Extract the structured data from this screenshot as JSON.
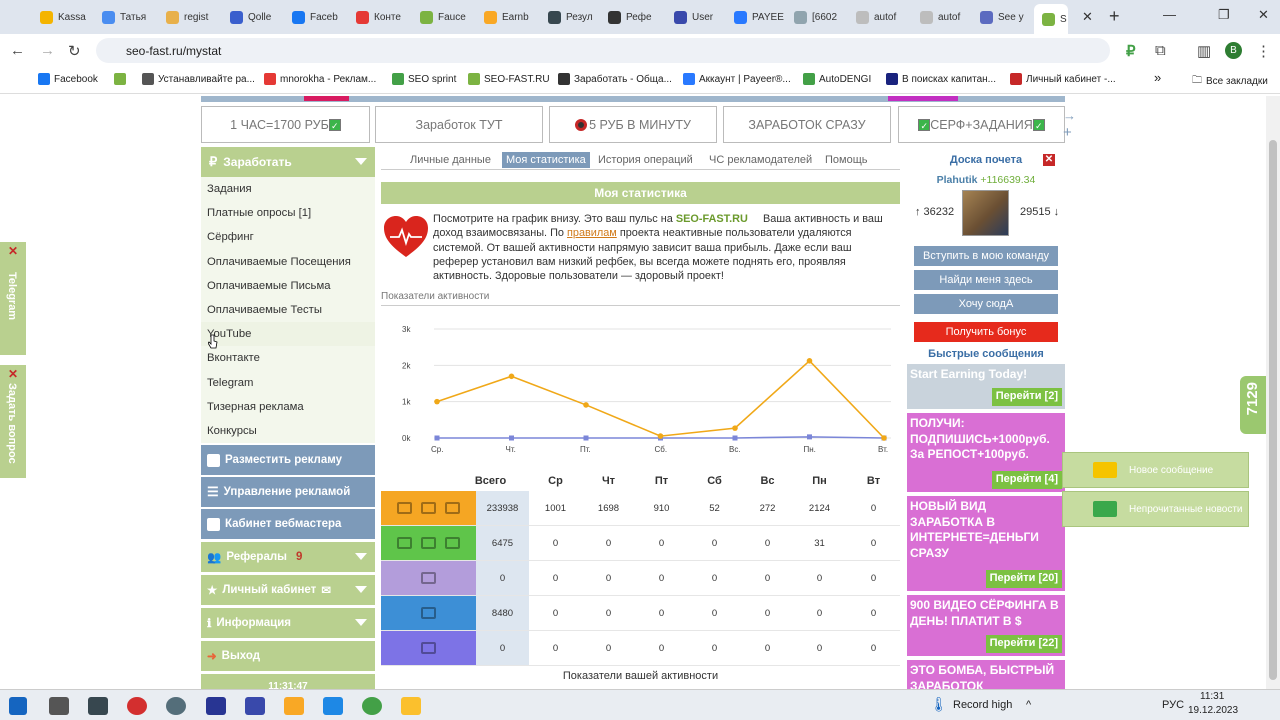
{
  "browser": {
    "tabs": [
      {
        "label": "Kassa",
        "color": "#f4b400"
      },
      {
        "label": "Татья",
        "color": "#4a8df0"
      },
      {
        "label": "regist",
        "color": "#e8b04a"
      },
      {
        "label": "Qolle",
        "color": "#3a5fcd"
      },
      {
        "label": "Faceb",
        "color": "#1877f2"
      },
      {
        "label": "Конте",
        "color": "#e53935"
      },
      {
        "label": "Fauce",
        "color": "#7cb342"
      },
      {
        "label": "Earnb",
        "color": "#f9a825"
      },
      {
        "label": "Резул",
        "color": "#37474f"
      },
      {
        "label": "Рефе",
        "color": "#333333"
      },
      {
        "label": "User",
        "color": "#3949ab"
      },
      {
        "label": "PAYEE",
        "color": "#2979ff"
      },
      {
        "label": "[6602",
        "color": "#90a4ae"
      },
      {
        "label": "autof",
        "color": "#bdbdbd"
      },
      {
        "label": "autof",
        "color": "#bdbdbd"
      },
      {
        "label": "See y",
        "color": "#5c6bc0"
      },
      {
        "label": "S",
        "color": "#7cb342"
      }
    ],
    "url": "seo-fast.ru/mystat",
    "bookmarks": [
      {
        "label": "Facebook",
        "color": "#1877f2"
      },
      {
        "label": "",
        "color": "#7cb342"
      },
      {
        "label": "Устанавливайте ра...",
        "color": "#555555"
      },
      {
        "label": "mnorokha - Реклам...",
        "color": "#e53935"
      },
      {
        "label": "SEO sprint",
        "color": "#43a047"
      },
      {
        "label": "SEO-FAST.RU",
        "color": "#7cb342"
      },
      {
        "label": "Заработать - Обща...",
        "color": "#333333"
      },
      {
        "label": "Аккаунт | Payeer®...",
        "color": "#2979ff"
      },
      {
        "label": "AutoDENGI",
        "color": "#43a047"
      },
      {
        "label": "В поисках капитан...",
        "color": "#1a237e"
      },
      {
        "label": "Личный кабинет -...",
        "color": "#c62828"
      }
    ],
    "all_bookmarks": "Все закладки",
    "profile": "B"
  },
  "top_buttons": [
    "1 ЧАС=1700 РУБ",
    "Заработок ТУТ",
    "5 РУБ В МИНУТУ",
    "ЗАРАБОТОК СРАЗУ",
    "СЕРФ+ЗАДАНИЯ"
  ],
  "sidebar": {
    "earn": "Заработать",
    "items": [
      "Задания",
      "Платные опросы [1]",
      "Сёрфинг",
      "Оплачиваемые Посещения",
      "Оплачиваемые Письма",
      "Оплачиваемые Тесты",
      "YouTube",
      "Вконтакте",
      "Telegram",
      "Тизерная реклама",
      "Конкурсы"
    ],
    "place_ad": "Разместить рекламу",
    "manage_ad": "Управление рекламой",
    "webmaster": "Кабинет вебмастера",
    "referrals": "Рефералы",
    "referrals_count": "9",
    "cabinet": "Личный кабинет",
    "info": "Информация",
    "logout": "Выход",
    "time": "11:31:47"
  },
  "subtabs": [
    "Личные данные",
    "Моя статистика",
    "История операций",
    "ЧС рекламодателей",
    "Помощь"
  ],
  "main": {
    "title": "Моя статистика",
    "intro_a": "Посмотрите на график внизу. Это ваш пульс на ",
    "brand": "SEO-FAST.RU",
    "intro_b": "     Ваша активность и ваш доход взаимосвязаны. По ",
    "rules": "правилам",
    "intro_c": " проекта неактивные пользователи удаляются системой. От вашей активности напрямую зависит ваша прибыль. Даже если ваш реферер установил вам низкий рефбек, вы всегда можете поднять его, проявляя активность. Здоровые пользователи — здоровый проект!",
    "activity_title": "Показатели активности",
    "footer": "Показатели вашей активности"
  },
  "chart_data": {
    "type": "line",
    "categories": [
      "Ср.",
      "Чт.",
      "Пт.",
      "Сб.",
      "Вс.",
      "Пн.",
      "Вт."
    ],
    "yticks": [
      "0k",
      "1k",
      "2k",
      "3k"
    ],
    "ylim": [
      0,
      3000
    ],
    "series": [
      {
        "color": "#f0a818",
        "values": [
          1001,
          1698,
          910,
          52,
          272,
          2124,
          0
        ]
      },
      {
        "color": "#7b86d8",
        "values": [
          0,
          0,
          0,
          0,
          0,
          31,
          0
        ]
      }
    ]
  },
  "stats": {
    "headers": [
      "Всего",
      "Ср",
      "Чт",
      "Пт",
      "Сб",
      "Вс",
      "Пн",
      "Вт"
    ],
    "rows": [
      {
        "color": "#f5a623",
        "total": "233938",
        "values": [
          "1001",
          "1698",
          "910",
          "52",
          "272",
          "2124",
          "0"
        ]
      },
      {
        "color": "#5fc54a",
        "total": "6475",
        "values": [
          "0",
          "0",
          "0",
          "0",
          "0",
          "31",
          "0"
        ]
      },
      {
        "color": "#b39ddb",
        "total": "0",
        "values": [
          "0",
          "0",
          "0",
          "0",
          "0",
          "0",
          "0"
        ]
      },
      {
        "color": "#3d8fd6",
        "total": "8480",
        "values": [
          "0",
          "0",
          "0",
          "0",
          "0",
          "0",
          "0"
        ]
      },
      {
        "color": "#7d73e6",
        "total": "0",
        "values": [
          "0",
          "0",
          "0",
          "0",
          "0",
          "0",
          "0"
        ]
      }
    ]
  },
  "right": {
    "honor": "Доска почета",
    "nick": "Plahutik",
    "nick_amount": "+116639.34",
    "left_num": "↑ 36232",
    "right_num": "29515 ↓",
    "btn1": "Вступить в мою команду",
    "btn2": "Найди меня здесь",
    "btn3": "Хочу сюдА",
    "bonus": "Получить бонус",
    "fast": "Быстрые сообщения",
    "ads": [
      {
        "text": "Start Earning Today!",
        "go": "Перейти [2]",
        "color": "#c9d3dc"
      },
      {
        "text": "ПОЛУЧИ: ПОДПИШИСЬ+1000руб. За РЕПОСТ+100руб.",
        "go": "Перейти [4]",
        "color": "#d96fd4"
      },
      {
        "text": "НОВЫЙ ВИД ЗАРАБОТКА В ИНТЕРНЕТЕ=ДЕНЬГИ СРАЗУ",
        "go": "Перейти [20]",
        "color": "#d96fd4"
      },
      {
        "text": "900 ВИДЕО СЁРФИНГА В ДЕНЬ! ПЛАТИТ В $",
        "go": "Перейти [22]",
        "color": "#d96fd4"
      },
      {
        "text": "ЭТО БОМБА, БЫСТРЫЙ ЗАРАБОТОК",
        "go": "",
        "color": "#d96fd4"
      }
    ]
  },
  "floating": {
    "telegram": "Telegram",
    "ask": "Задать вопрос",
    "new_msg": "Новое сообщение",
    "unread": "Непрочитанные новости",
    "counter": "7129"
  },
  "taskbar": {
    "record": "Record high",
    "lang": "РУС",
    "time": "11:31",
    "date": "19.12.2023"
  }
}
